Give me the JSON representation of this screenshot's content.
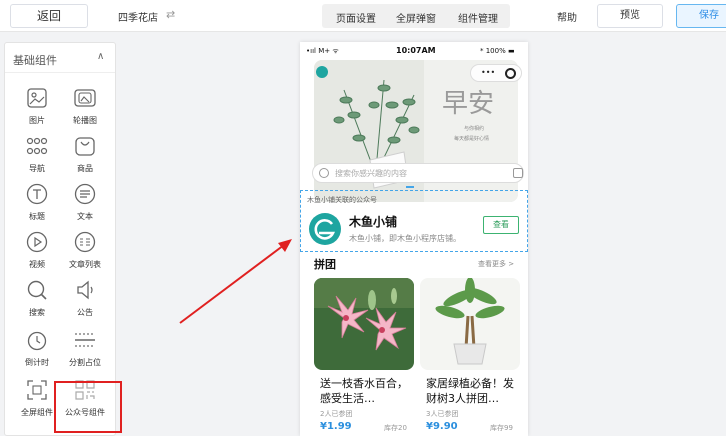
{
  "topbar": {
    "back_label": "返回",
    "store_name": "四季花店",
    "swap_icon": "⇄",
    "menu": [
      "页面设置",
      "全屏弹窗",
      "组件管理"
    ],
    "help": "帮助",
    "preview": "预览",
    "save": "保存"
  },
  "panel": {
    "title": "基础组件",
    "items": [
      {
        "label": "图片",
        "icon": "image-icon"
      },
      {
        "label": "轮播图",
        "icon": "carousel-icon"
      },
      {
        "label": "导航",
        "icon": "nav-grid-icon"
      },
      {
        "label": "商品",
        "icon": "bag-icon"
      },
      {
        "label": "标题",
        "icon": "title-icon"
      },
      {
        "label": "文本",
        "icon": "text-icon"
      },
      {
        "label": "视频",
        "icon": "video-icon"
      },
      {
        "label": "文章列表",
        "icon": "article-list-icon"
      },
      {
        "label": "搜索",
        "icon": "search-icon"
      },
      {
        "label": "公告",
        "icon": "announcement-icon"
      },
      {
        "label": "倒计时",
        "icon": "countdown-icon"
      },
      {
        "label": "分割占位",
        "icon": "divider-icon"
      },
      {
        "label": "全屏组件",
        "icon": "fullscreen-icon"
      },
      {
        "label": "公众号组件",
        "icon": "official-account-icon"
      }
    ]
  },
  "phone": {
    "status": {
      "signal": "•ııl M+ ᯤ",
      "time": "10:07AM",
      "battery": "* 100% ▬"
    },
    "banner": {
      "logo_text": "早安",
      "line1": "与你相约",
      "line2": "每天都是好心情"
    },
    "capsule": {
      "dots": "•••"
    },
    "search_placeholder": "搜索你感兴趣的内容",
    "official_account": {
      "tag": "木鱼小铺关联的公众号",
      "name": "木鱼小铺",
      "desc": "木鱼小铺，即木鱼小程序店铺。",
      "button": "查看"
    },
    "section": {
      "title": "拼团",
      "more": "查看更多 >"
    },
    "products": [
      {
        "title": "送一枝香水百合，感受生活…",
        "joined": "2人已参团",
        "price": "¥1.99",
        "stock": "库存20"
      },
      {
        "title": "家居绿植必备！发财树3人拼团…",
        "joined": "3人已参团",
        "price": "¥9.90",
        "stock": "库存99"
      }
    ]
  },
  "colors": {
    "accent": "#2e8de6",
    "highlight": "#e02020",
    "dashed": "#44a5e8",
    "oa_logo": "#1ea5a0"
  }
}
